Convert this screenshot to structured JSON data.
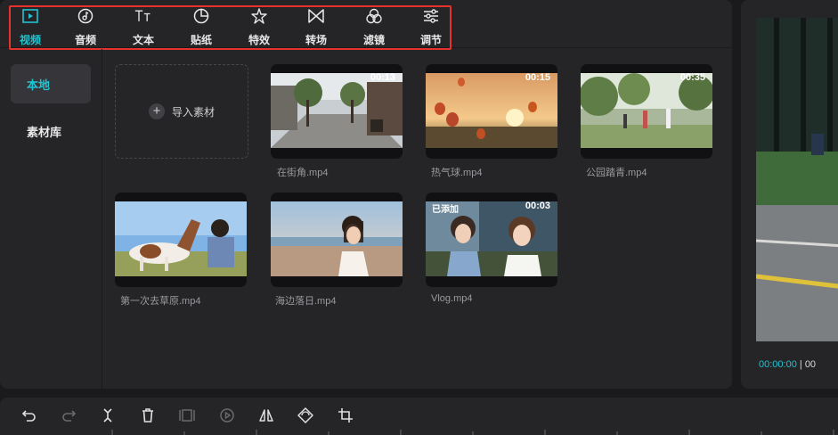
{
  "toolbar": {
    "items": [
      {
        "label": "视频",
        "icon": "video-icon",
        "active": true
      },
      {
        "label": "音频",
        "icon": "audio-icon",
        "active": false
      },
      {
        "label": "文本",
        "icon": "text-icon",
        "active": false
      },
      {
        "label": "贴纸",
        "icon": "sticker-icon",
        "active": false
      },
      {
        "label": "特效",
        "icon": "effects-icon",
        "active": false
      },
      {
        "label": "转场",
        "icon": "transition-icon",
        "active": false
      },
      {
        "label": "滤镜",
        "icon": "filter-icon",
        "active": false
      },
      {
        "label": "调节",
        "icon": "adjust-icon",
        "active": false
      }
    ]
  },
  "sidebar": {
    "items": [
      {
        "label": "本地",
        "active": true
      },
      {
        "label": "素材库",
        "active": false
      }
    ]
  },
  "media": {
    "import_label": "导入素材",
    "clips": [
      {
        "name": "在街角.mp4",
        "duration": "00:13",
        "added_badge": ""
      },
      {
        "name": "热气球.mp4",
        "duration": "00:15",
        "added_badge": ""
      },
      {
        "name": "公园踏青.mp4",
        "duration": "00:35",
        "added_badge": ""
      },
      {
        "name": "第一次去草原.mp4",
        "duration": "",
        "added_badge": ""
      },
      {
        "name": "海边落日.mp4",
        "duration": "",
        "added_badge": ""
      },
      {
        "name": "Vlog.mp4",
        "duration": "00:03",
        "added_badge": "已添加"
      }
    ]
  },
  "preview": {
    "current_time": "00:00:00",
    "separator": "|",
    "total_time": "00"
  },
  "bottom_toolbar": {
    "icons": [
      "undo-icon",
      "redo-icon",
      "split-icon",
      "delete-icon",
      "freeze-frame-icon",
      "play-icon",
      "mirror-icon",
      "rotate-icon",
      "crop-icon"
    ]
  },
  "colors": {
    "accent": "#20c3d0",
    "highlight_box": "#e5322c",
    "panel_bg": "#252528",
    "app_bg": "#1a1a1c"
  }
}
